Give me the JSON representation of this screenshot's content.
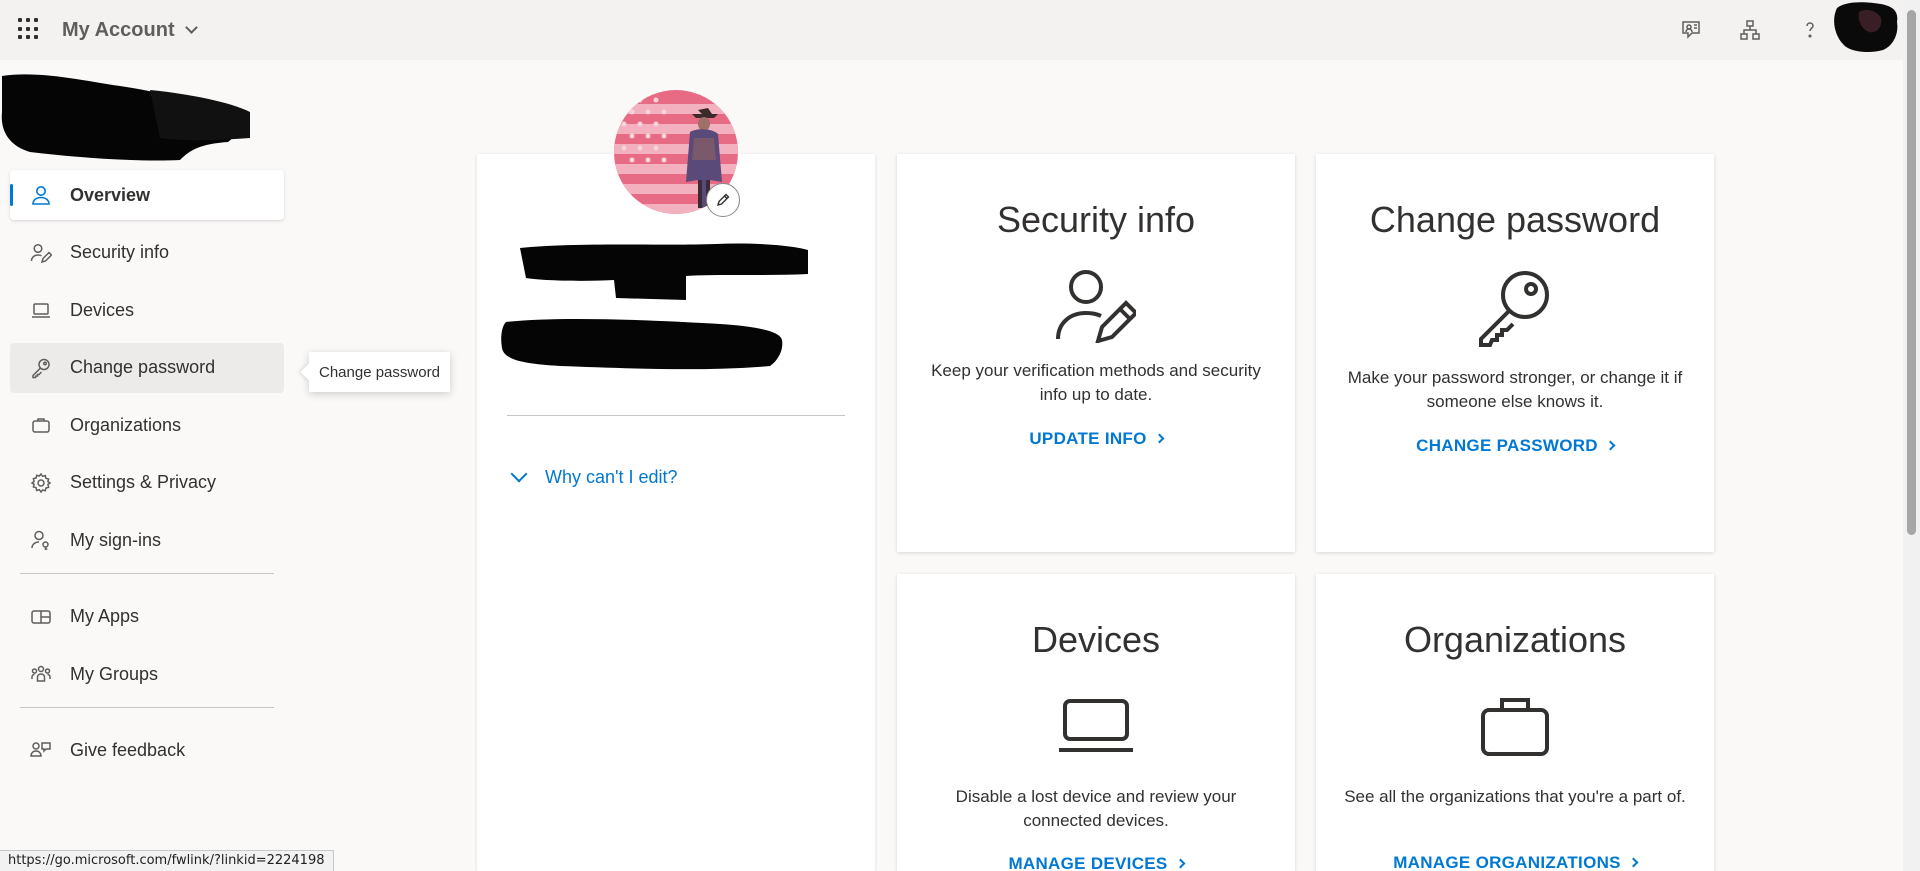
{
  "header": {
    "app_title": "My Account",
    "icons": [
      "app-launcher-icon",
      "chevron-down-icon",
      "feedback-icon",
      "organization-chart-icon",
      "help-icon",
      "user-avatar"
    ]
  },
  "sidebar": {
    "items": [
      {
        "label": "Overview",
        "icon": "person-icon",
        "active": true
      },
      {
        "label": "Security info",
        "icon": "person-edit-icon"
      },
      {
        "label": "Devices",
        "icon": "laptop-icon"
      },
      {
        "label": "Change password",
        "icon": "key-icon",
        "hovered": true
      },
      {
        "label": "Organizations",
        "icon": "briefcase-icon"
      },
      {
        "label": "Settings & Privacy",
        "icon": "gear-icon"
      },
      {
        "label": "My sign-ins",
        "icon": "person-key-icon"
      },
      {
        "label": "My Apps",
        "icon": "apps-icon"
      },
      {
        "label": "My Groups",
        "icon": "people-team-icon"
      },
      {
        "label": "Give feedback",
        "icon": "feedback-icon"
      }
    ],
    "tooltip": "Change password"
  },
  "profile": {
    "why_edit": "Why can't I edit?"
  },
  "tiles": {
    "security": {
      "title": "Security info",
      "description": "Keep your verification methods and security info up to date.",
      "link": "UPDATE INFO"
    },
    "password": {
      "title": "Change password",
      "description": "Make your password stronger, or change it if someone else knows it.",
      "link": "CHANGE PASSWORD"
    },
    "devices": {
      "title": "Devices",
      "description": "Disable a lost device and review your connected devices.",
      "link": "MANAGE DEVICES"
    },
    "organizations": {
      "title": "Organizations",
      "description": "See all the organizations that you're a part of.",
      "link": "MANAGE ORGANIZATIONS"
    }
  },
  "status_bar": {
    "url": "https://go.microsoft.com/fwlink/?linkid=2224198"
  },
  "colors": {
    "accent": "#0078d4",
    "page_bg": "#faf9f8",
    "topbar_bg": "#f3f2f1",
    "text": "#323130"
  }
}
